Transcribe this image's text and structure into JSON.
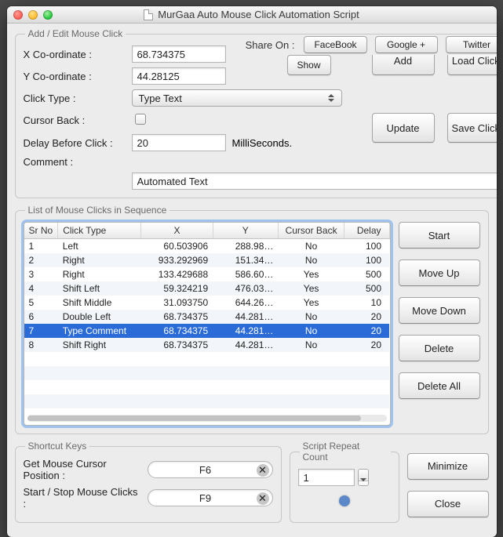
{
  "window": {
    "title": "MurGaa Auto Mouse Click Automation Script"
  },
  "share": {
    "label": "Share On :",
    "facebook": "FaceBook",
    "google": "Google +",
    "twitter": "Twitter"
  },
  "edit": {
    "legend": "Add / Edit Mouse Click",
    "x_label": "X Co-ordinate :",
    "y_label": "Y Co-ordinate :",
    "click_type_label": "Click Type :",
    "cursor_back_label": "Cursor Back :",
    "delay_label": "Delay Before Click :",
    "delay_unit": "MilliSeconds.",
    "comment_label": "Comment :",
    "x_value": "68.734375",
    "y_value": "44.28125",
    "click_type_value": "Type Text",
    "delay_value": "20",
    "comment_value": "Automated Text",
    "show_btn": "Show",
    "add_btn": "Add",
    "load_btn": "Load Clicks",
    "update_btn": "Update",
    "save_btn": "Save Clicks"
  },
  "list": {
    "legend": "List of Mouse Clicks in Sequence",
    "headers": {
      "sr": "Sr No",
      "ct": "Click Type",
      "x": "X",
      "y": "Y",
      "cb": "Cursor Back",
      "dl": "Delay"
    },
    "btns": {
      "start": "Start",
      "up": "Move Up",
      "down": "Move Down",
      "del": "Delete",
      "delall": "Delete All"
    },
    "rows": [
      {
        "sr": "1",
        "ct": "Left",
        "x": "60.503906",
        "y": "288.98…",
        "cb": "No",
        "dl": "100"
      },
      {
        "sr": "2",
        "ct": "Right",
        "x": "933.292969",
        "y": "151.34…",
        "cb": "No",
        "dl": "100"
      },
      {
        "sr": "3",
        "ct": "Right",
        "x": "133.429688",
        "y": "586.60…",
        "cb": "Yes",
        "dl": "500"
      },
      {
        "sr": "4",
        "ct": "Shift Left",
        "x": "59.324219",
        "y": "476.03…",
        "cb": "Yes",
        "dl": "500"
      },
      {
        "sr": "5",
        "ct": "Shift Middle",
        "x": "31.093750",
        "y": "644.26…",
        "cb": "Yes",
        "dl": "10"
      },
      {
        "sr": "6",
        "ct": "Double Left",
        "x": "68.734375",
        "y": "44.281…",
        "cb": "No",
        "dl": "20"
      },
      {
        "sr": "7",
        "ct": "Type Comment",
        "x": "68.734375",
        "y": "44.281…",
        "cb": "No",
        "dl": "20"
      },
      {
        "sr": "8",
        "ct": "Shift Right",
        "x": "68.734375",
        "y": "44.281…",
        "cb": "No",
        "dl": "20"
      }
    ],
    "selected_index": 6
  },
  "shortcuts": {
    "legend": "Shortcut Keys",
    "pos_label": "Get Mouse Cursor Position :",
    "pos_value": "F6",
    "ss_label": "Start / Stop Mouse Clicks :",
    "ss_value": "F9"
  },
  "repeat": {
    "legend": "Script Repeat Count",
    "value": "1"
  },
  "footer": {
    "minimize": "Minimize",
    "close": "Close"
  }
}
